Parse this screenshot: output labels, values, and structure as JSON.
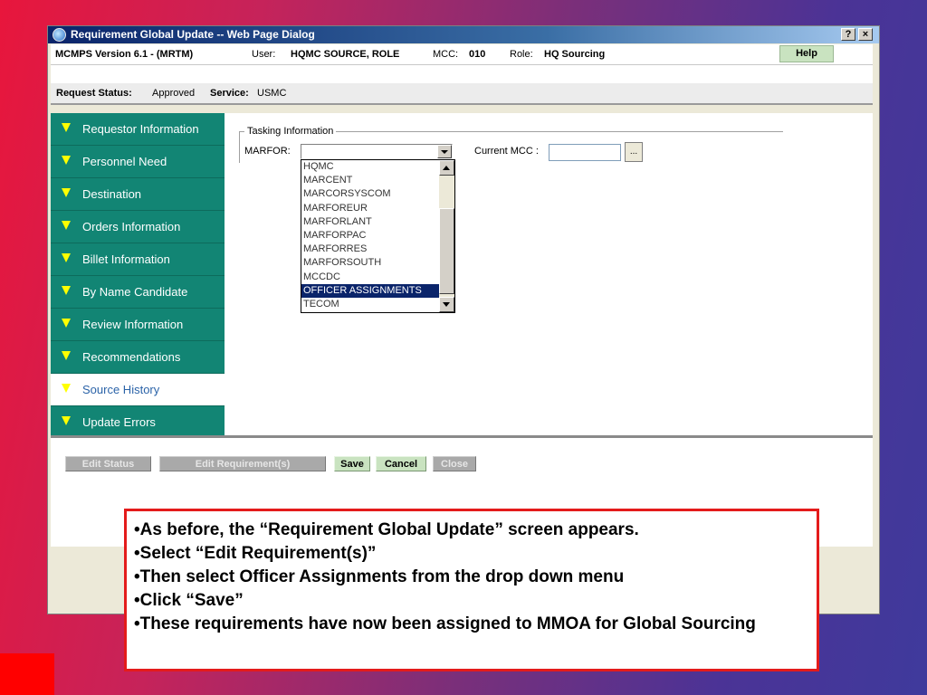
{
  "window": {
    "title": "Requirement Global Update -- Web Page Dialog",
    "help_btn": "?",
    "close_btn": "×"
  },
  "infobar": {
    "version": "MCMPS Version 6.1 - (MRTM)",
    "user_label": "User:",
    "user_value": "HQMC SOURCE, ROLE",
    "mcc_label": "MCC:",
    "mcc_value": "010",
    "role_label": "Role:",
    "role_value": "HQ Sourcing",
    "help_label": "Help"
  },
  "status": {
    "request_label": "Request Status:",
    "request_value": "Approved",
    "service_label": "Service:",
    "service_value": "USMC"
  },
  "sidebar": {
    "items": [
      {
        "label": "Requestor Information"
      },
      {
        "label": "Personnel Need"
      },
      {
        "label": "Destination"
      },
      {
        "label": "Orders Information"
      },
      {
        "label": "Billet Information"
      },
      {
        "label": "By Name Candidate"
      },
      {
        "label": "Review Information"
      },
      {
        "label": "Recommendations"
      },
      {
        "label": "Source History"
      },
      {
        "label": "Update Errors"
      }
    ],
    "active_index": 8
  },
  "tasking": {
    "legend": "Tasking Information",
    "marfor_label": "MARFOR:",
    "marfor_value": "",
    "current_mcc_label": "Current MCC :",
    "current_mcc_value": "",
    "lookup_label": "..."
  },
  "dropdown": {
    "options": [
      "HQMC",
      "MARCENT",
      "MARCORSYSCOM",
      "MARFOREUR",
      "MARFORLANT",
      "MARFORPAC",
      "MARFORRES",
      "MARFORSOUTH",
      "MCCDC",
      "OFFICER ASSIGNMENTS",
      "TECOM"
    ],
    "selected": "OFFICER ASSIGNMENTS"
  },
  "actions": {
    "edit_status": "Edit Status",
    "edit_requirements": "Edit Requirement(s)",
    "save": "Save",
    "cancel": "Cancel",
    "close": "Close"
  },
  "note": {
    "lines": [
      "•As before, the “Requirement Global Update” screen appears.",
      "•Select “Edit Requirement(s)”",
      "•Then select Officer Assignments from the drop down menu",
      "•Click “Save”",
      "•These requirements have now been assigned to MMOA for Global Sourcing"
    ]
  }
}
